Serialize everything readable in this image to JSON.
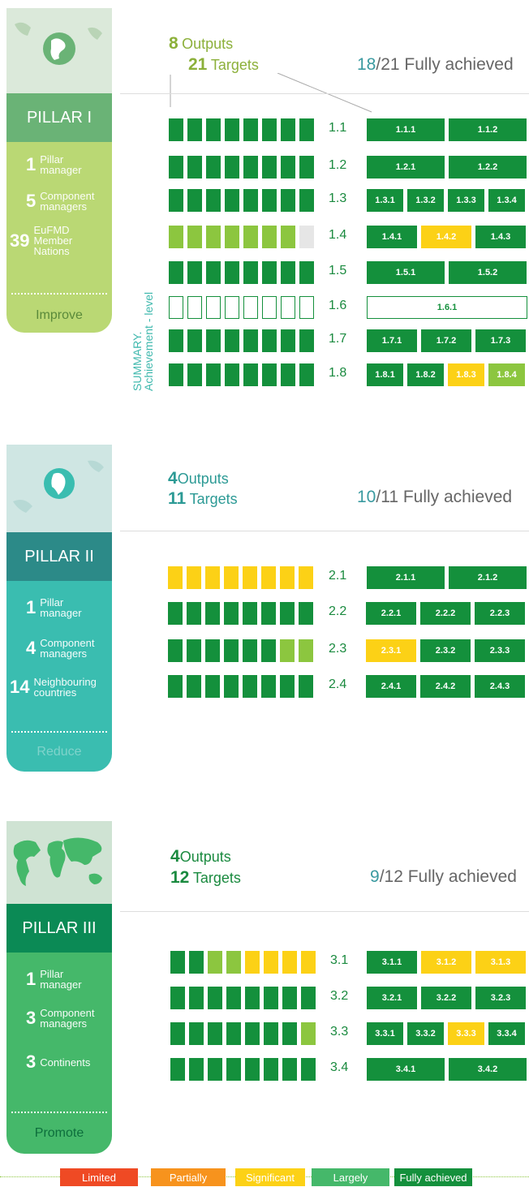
{
  "colors": {
    "full": "#14903c",
    "largely": "#8cc63f",
    "significant": "#fcd116",
    "partial": "#f7931d",
    "limited": "#ef4a24",
    "none": "#e6e6e6",
    "p1": "#bad874",
    "p1dark": "#6ab376",
    "p2": "#3abdb0",
    "p2dark": "#2c8a88",
    "p3": "#45b86a",
    "p3dark": "#0b8a55"
  },
  "pillars": [
    {
      "title": "PILLAR I",
      "stats": [
        {
          "num": "1",
          "label": "Pillar manager"
        },
        {
          "num": "5",
          "label": "Component managers"
        },
        {
          "num": "39",
          "label": "EuFMD Member Nations"
        }
      ],
      "footer": "Improve",
      "outputs_num": "8",
      "outputs_label": "Outputs",
      "targets_num": "21",
      "targets_label": "Targets",
      "achieved_num": "18",
      "achieved_total": "/21 Fully achieved"
    },
    {
      "title": "PILLAR II",
      "stats": [
        {
          "num": "1",
          "label": "Pillar manager"
        },
        {
          "num": "4",
          "label": "Component managers"
        },
        {
          "num": "14",
          "label": "Neighbouring countries"
        }
      ],
      "footer": "Reduce",
      "outputs_num": "4",
      "outputs_label": "Outputs",
      "targets_num": "11",
      "targets_label": "Targets",
      "achieved_num": "10",
      "achieved_total": "/11 Fully achieved"
    },
    {
      "title": "PILLAR III",
      "stats": [
        {
          "num": "1",
          "label": "Pillar manager"
        },
        {
          "num": "3",
          "label": "Component managers"
        },
        {
          "num": "3",
          "label": "Continents"
        }
      ],
      "footer": "Promote",
      "outputs_num": "4",
      "outputs_label": "Outputs",
      "targets_num": "12",
      "targets_label": "Targets",
      "achieved_num": "9",
      "achieved_total": "/12 Fully achieved"
    }
  ],
  "summary_label_1": "SUMMARY.",
  "summary_label_2": "Achievement - level",
  "chart_data": {
    "type": "table",
    "status_legend": [
      "Limited",
      "Partially",
      "Significant",
      "Largely",
      "Fully achieved"
    ],
    "rows": [
      {
        "output": "1.1",
        "bars": [
          "F",
          "F",
          "F",
          "F",
          "F",
          "F",
          "F",
          "F"
        ],
        "targets": [
          [
            "1.1.1",
            "F"
          ],
          [
            "1.1.2",
            "F"
          ]
        ]
      },
      {
        "output": "1.2",
        "bars": [
          "F",
          "F",
          "F",
          "F",
          "F",
          "F",
          "F",
          "F"
        ],
        "targets": [
          [
            "1.2.1",
            "F"
          ],
          [
            "1.2.2",
            "F"
          ]
        ]
      },
      {
        "output": "1.3",
        "bars": [
          "F",
          "F",
          "F",
          "F",
          "F",
          "F",
          "F",
          "F"
        ],
        "targets": [
          [
            "1.3.1",
            "F"
          ],
          [
            "1.3.2",
            "F"
          ],
          [
            "1.3.3",
            "F"
          ],
          [
            "1.3.4",
            "F"
          ]
        ]
      },
      {
        "output": "1.4",
        "bars": [
          "L",
          "L",
          "L",
          "L",
          "L",
          "L",
          "L",
          "N"
        ],
        "targets": [
          [
            "1.4.1",
            "F"
          ],
          [
            "1.4.2",
            "S"
          ],
          [
            "1.4.3",
            "F"
          ]
        ]
      },
      {
        "output": "1.5",
        "bars": [
          "F",
          "F",
          "F",
          "F",
          "F",
          "F",
          "F",
          "F"
        ],
        "targets": [
          [
            "1.5.1",
            "F"
          ],
          [
            "1.5.2",
            "F"
          ]
        ]
      },
      {
        "output": "1.6",
        "bars": [
          "O",
          "O",
          "O",
          "O",
          "O",
          "O",
          "O",
          "O"
        ],
        "targets": [
          [
            "1.6.1",
            "O"
          ]
        ]
      },
      {
        "output": "1.7",
        "bars": [
          "F",
          "F",
          "F",
          "F",
          "F",
          "F",
          "F",
          "F"
        ],
        "targets": [
          [
            "1.7.1",
            "F"
          ],
          [
            "1.7.2",
            "F"
          ],
          [
            "1.7.3",
            "F"
          ]
        ]
      },
      {
        "output": "1.8",
        "bars": [
          "F",
          "F",
          "F",
          "F",
          "F",
          "F",
          "F",
          "F"
        ],
        "targets": [
          [
            "1.8.1",
            "F"
          ],
          [
            "1.8.2",
            "F"
          ],
          [
            "1.8.3",
            "S"
          ],
          [
            "1.8.4",
            "L"
          ]
        ]
      },
      {
        "output": "2.1",
        "bars": [
          "S",
          "S",
          "S",
          "S",
          "S",
          "S",
          "S",
          "S"
        ],
        "targets": [
          [
            "2.1.1",
            "F"
          ],
          [
            "2.1.2",
            "F"
          ]
        ]
      },
      {
        "output": "2.2",
        "bars": [
          "F",
          "F",
          "F",
          "F",
          "F",
          "F",
          "F",
          "F"
        ],
        "targets": [
          [
            "2.2.1",
            "F"
          ],
          [
            "2.2.2",
            "F"
          ],
          [
            "2.2.3",
            "F"
          ]
        ]
      },
      {
        "output": "2.3",
        "bars": [
          "F",
          "F",
          "F",
          "F",
          "F",
          "F",
          "L",
          "L"
        ],
        "targets": [
          [
            "2.3.1",
            "S"
          ],
          [
            "2.3.2",
            "F"
          ],
          [
            "2.3.3",
            "F"
          ]
        ]
      },
      {
        "output": "2.4",
        "bars": [
          "F",
          "F",
          "F",
          "F",
          "F",
          "F",
          "F",
          "F"
        ],
        "targets": [
          [
            "2.4.1",
            "F"
          ],
          [
            "2.4.2",
            "F"
          ],
          [
            "2.4.3",
            "F"
          ]
        ]
      },
      {
        "output": "3.1",
        "bars": [
          "F",
          "F",
          "L",
          "L",
          "S",
          "S",
          "S",
          "S"
        ],
        "targets": [
          [
            "3.1.1",
            "F"
          ],
          [
            "3.1.2",
            "S"
          ],
          [
            "3.1.3",
            "S"
          ]
        ]
      },
      {
        "output": "3.2",
        "bars": [
          "F",
          "F",
          "F",
          "F",
          "F",
          "F",
          "F",
          "F"
        ],
        "targets": [
          [
            "3.2.1",
            "F"
          ],
          [
            "3.2.2",
            "F"
          ],
          [
            "3.2.3",
            "F"
          ]
        ]
      },
      {
        "output": "3.3",
        "bars": [
          "F",
          "F",
          "F",
          "F",
          "F",
          "F",
          "F",
          "L"
        ],
        "targets": [
          [
            "3.3.1",
            "F"
          ],
          [
            "3.3.2",
            "F"
          ],
          [
            "3.3.3",
            "S"
          ],
          [
            "3.3.4",
            "F"
          ]
        ]
      },
      {
        "output": "3.4",
        "bars": [
          "F",
          "F",
          "F",
          "F",
          "F",
          "F",
          "F",
          "F"
        ],
        "targets": [
          [
            "3.4.1",
            "F"
          ],
          [
            "3.4.2",
            "F"
          ]
        ]
      }
    ]
  }
}
